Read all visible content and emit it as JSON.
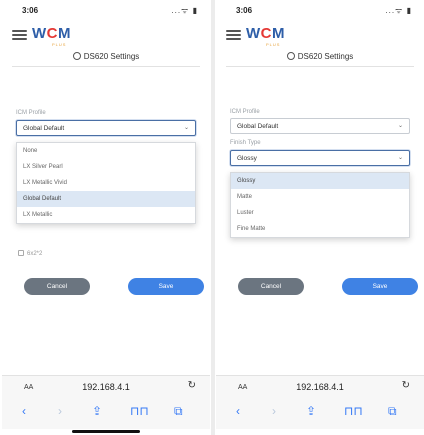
{
  "status_bar": {
    "time": "3:06",
    "icons": "...ᯤ ▮"
  },
  "logo": {
    "part1": "W",
    "part2": "C",
    "part3": "M",
    "sub": "PLUS"
  },
  "left": {
    "title": "DS620 Settings",
    "icm_label": "ICM Profile",
    "icm_value": "Global Default",
    "dropdown_options": [
      "None",
      "LX Silver Pearl",
      "LX Metallic Vivid",
      "Global Default",
      "LX Metallic"
    ],
    "selected_option": "Global Default",
    "checkbox_label": "6x2*2",
    "cancel_label": "Cancel",
    "save_label": "Save"
  },
  "right": {
    "title": "DS620 Settings",
    "icm_label": "ICM Profile",
    "icm_value": "Global Default",
    "finish_label": "Finish Type",
    "finish_value": "Glossy",
    "dropdown_options": [
      "Glossy",
      "Matte",
      "Luster",
      "Fine Matte"
    ],
    "selected_option": "Glossy",
    "cancel_label": "Cancel",
    "save_label": "Save"
  },
  "browser": {
    "aa": "AA",
    "url": "192.168.4.1",
    "icons": {
      "reload": "reload-icon",
      "back": "back-icon",
      "forward": "forward-icon",
      "share": "share-icon",
      "bookmarks": "bookmarks-icon",
      "tabs": "tabs-icon"
    }
  },
  "colors": {
    "brand_blue": "#2e5ea8",
    "brand_red": "#e53935",
    "save_button": "#3f82e4",
    "cancel_button": "#6b7580",
    "selected_option_bg": "#dce7f4"
  }
}
